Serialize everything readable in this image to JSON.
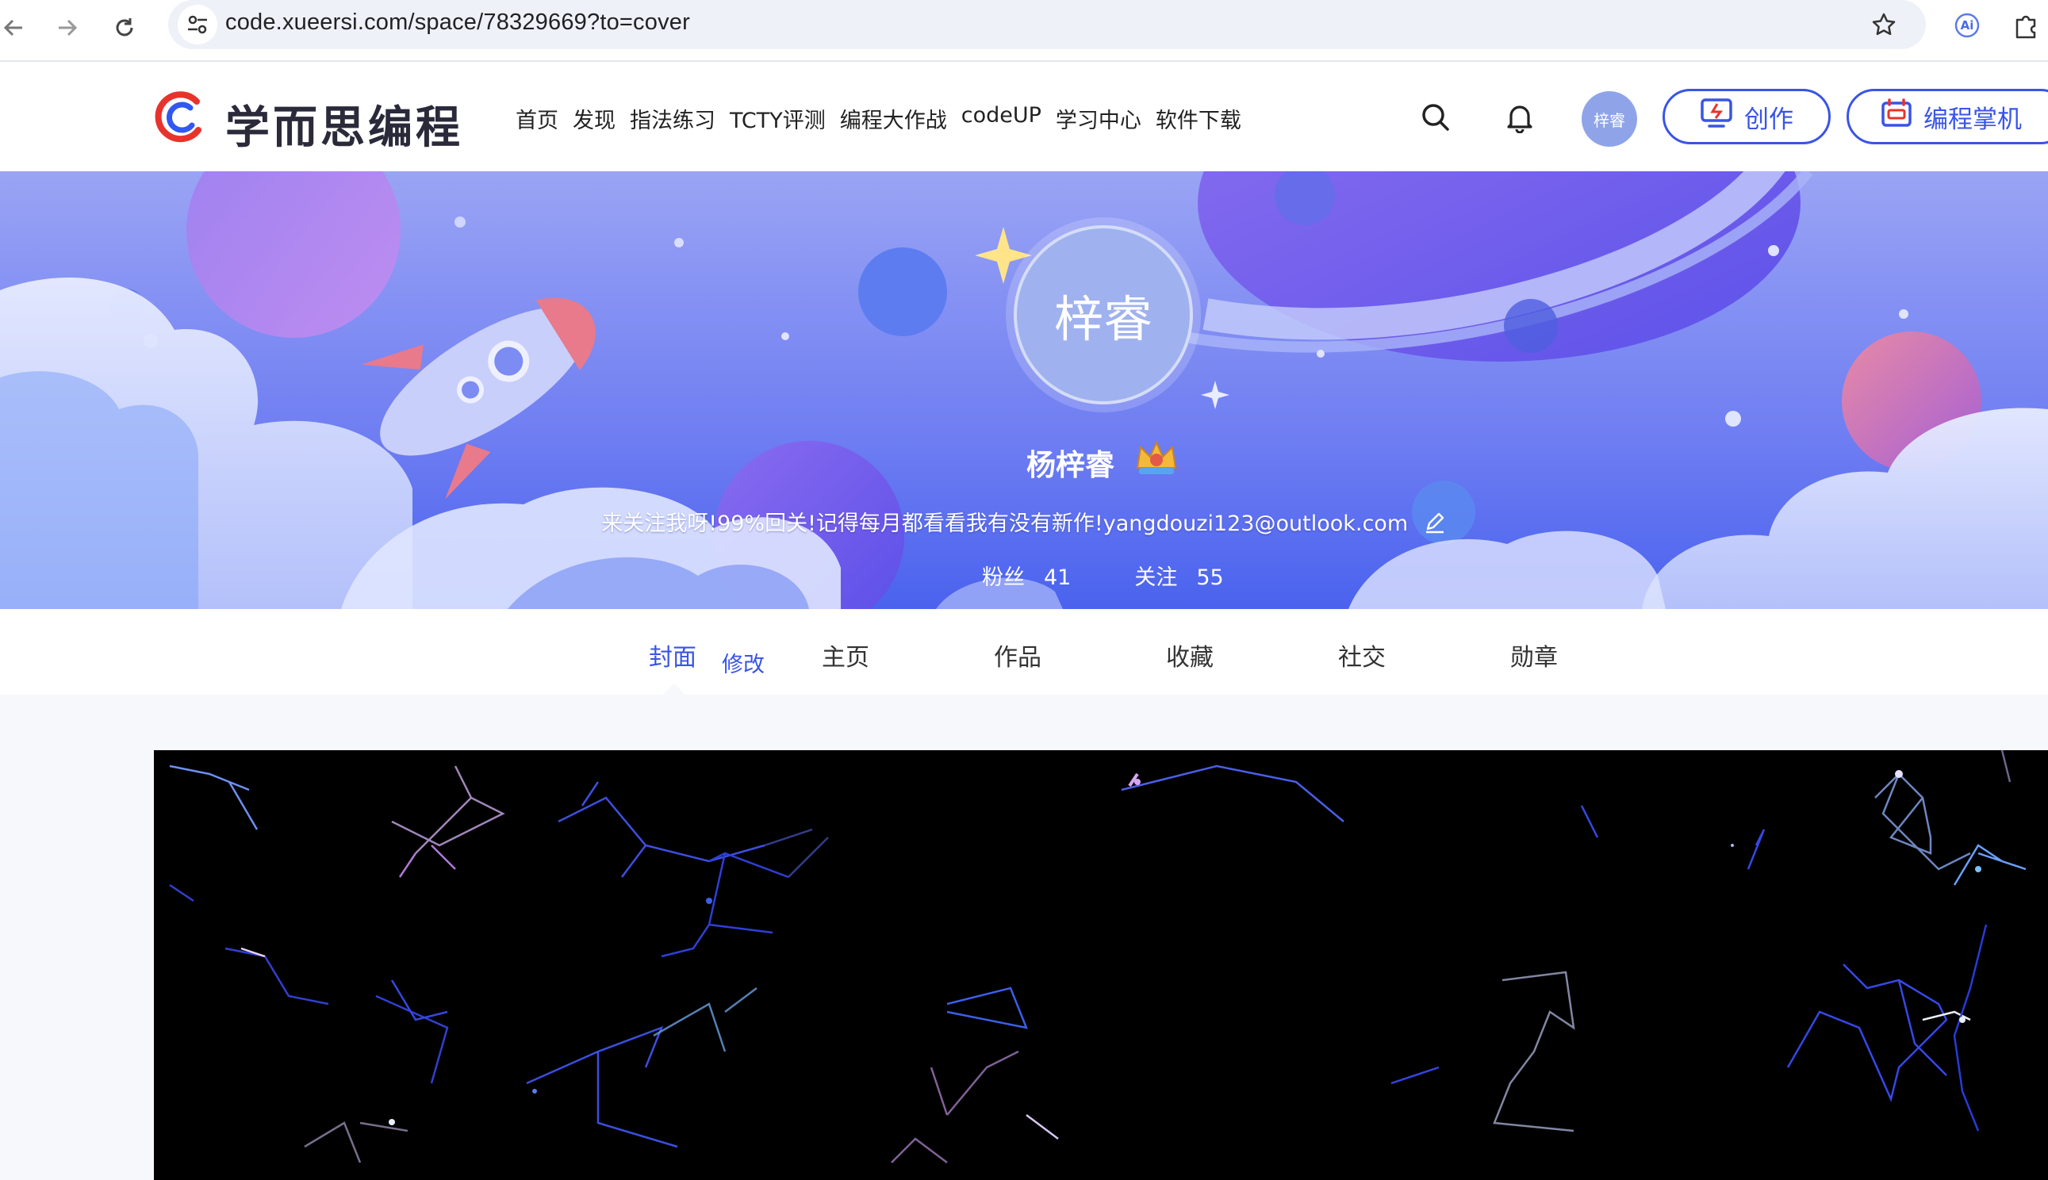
{
  "browser": {
    "url": "code.xueersi.com/space/78329669?to=cover",
    "ext_label": "Ai"
  },
  "header": {
    "logo_text": "学而思编程",
    "nav": [
      "首页",
      "发现",
      "指法练习",
      "TCTY评测",
      "编程大作战",
      "codeUP",
      "学习中心",
      "软件下载"
    ],
    "user_avatar_text": "梓睿",
    "create_label": "创作",
    "handheld_label": "编程掌机"
  },
  "profile": {
    "avatar_text": "梓睿",
    "name": "杨梓睿",
    "bio": "来关注我呀!99%回关!记得每月都看看我有没有新作!yangdouzi123@outlook.com",
    "fans_label": "粉丝",
    "fans_count": "41",
    "follow_label": "关注",
    "follow_count": "55"
  },
  "tabs": {
    "items": [
      "封面",
      "主页",
      "作品",
      "收藏",
      "社交",
      "勋章"
    ],
    "active": "封面",
    "edit_label": "修改"
  },
  "colors": {
    "accent": "#3954e6",
    "banner_top": "#8d97f2",
    "banner_bottom": "#4a62ee"
  }
}
